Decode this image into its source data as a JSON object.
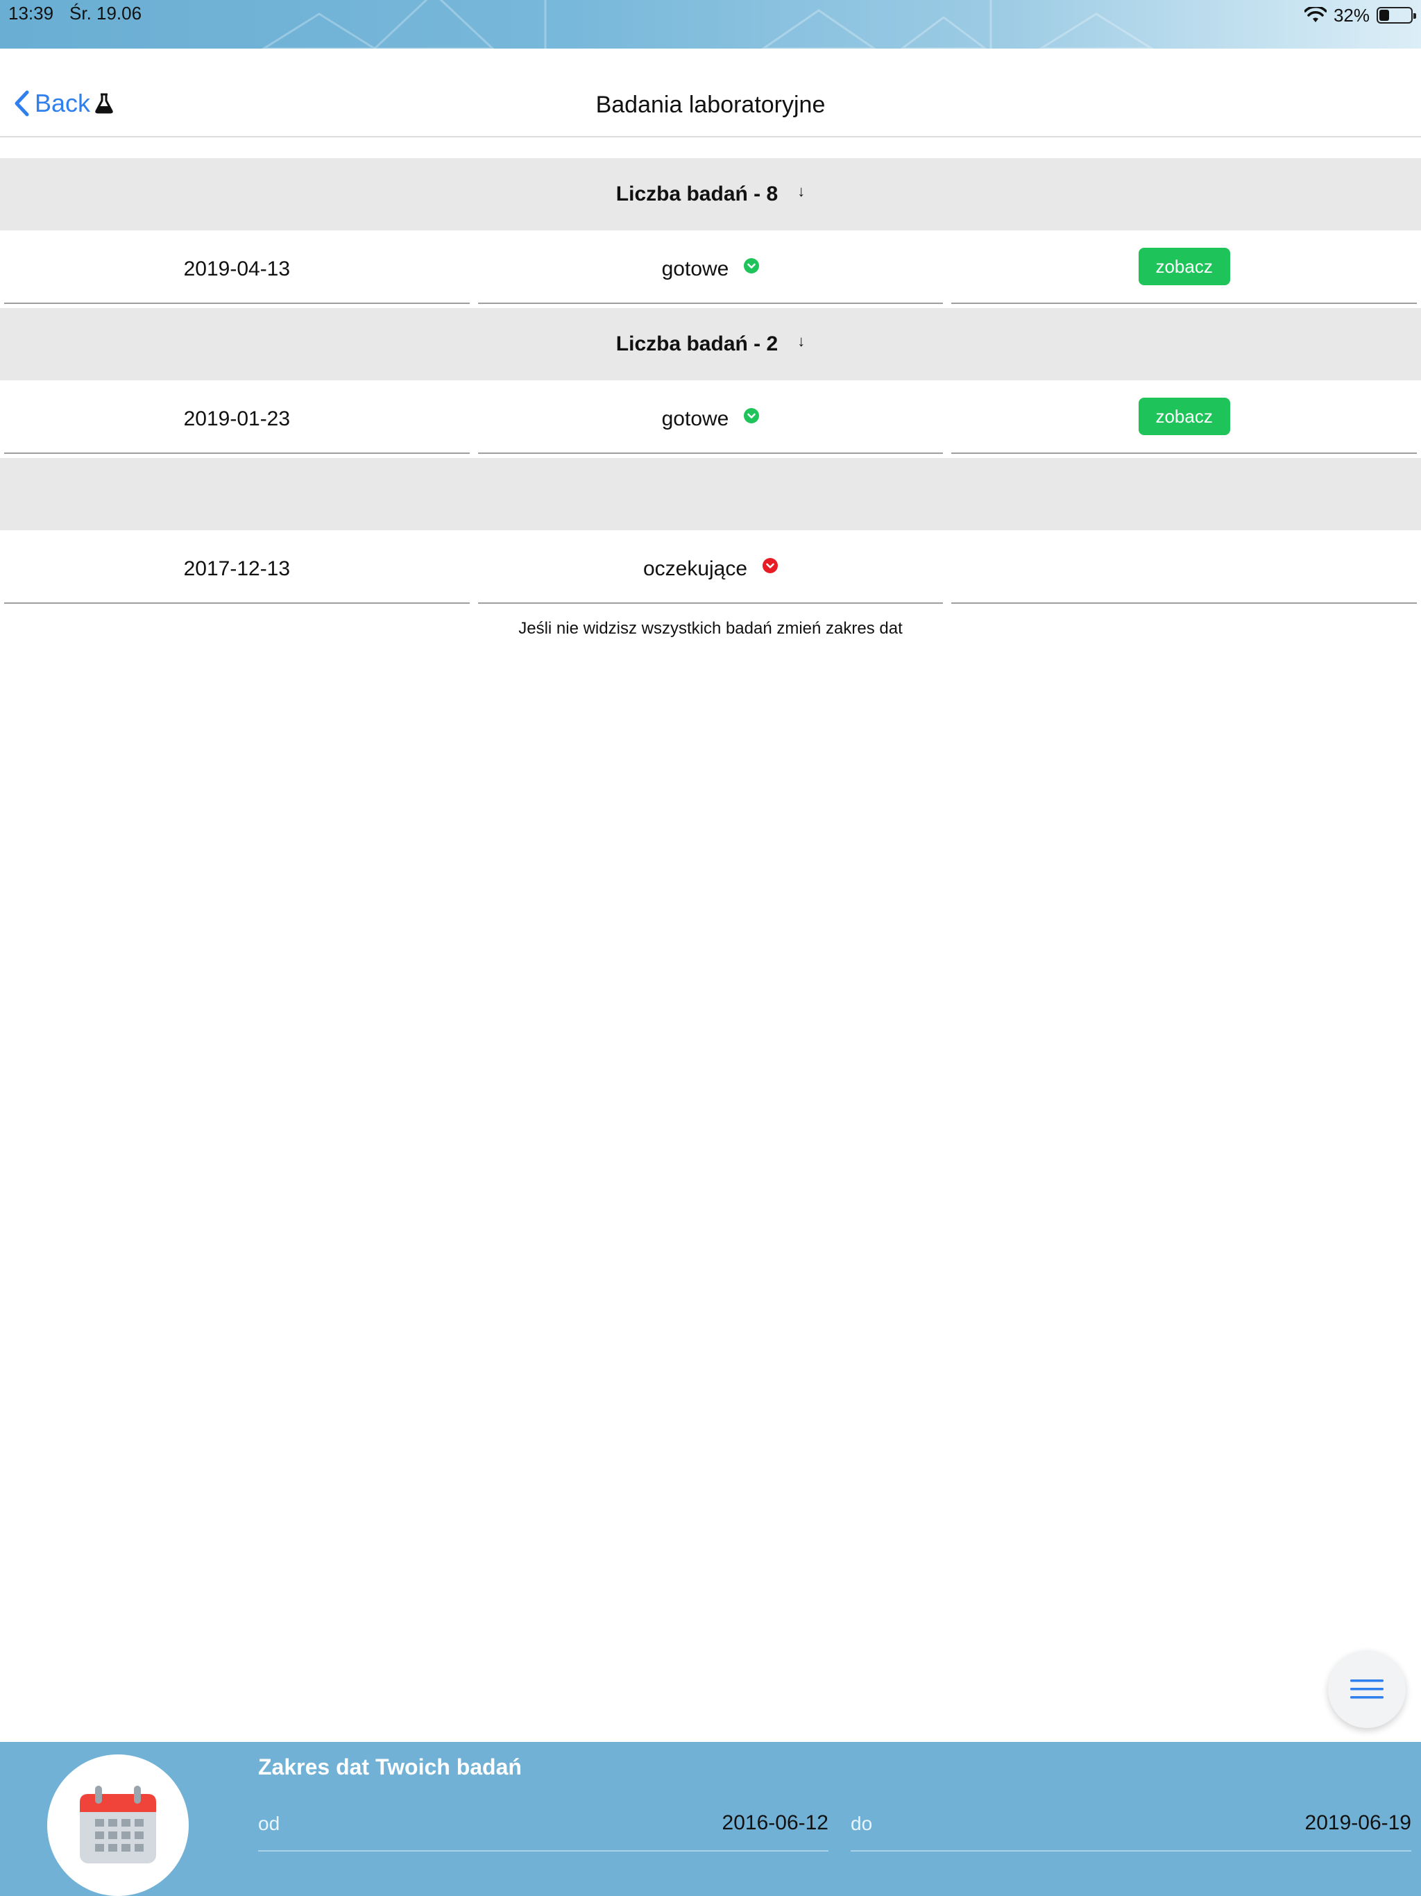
{
  "status_bar": {
    "time": "13:39",
    "date": "Śr. 19.06",
    "battery_percent": "32%",
    "battery_level": 0.32
  },
  "nav": {
    "back_label": "Back",
    "title": "Badania laboratoryjne"
  },
  "groups": [
    {
      "header": "Liczba badań - 8",
      "sort_arrow": "↓",
      "rows": [
        {
          "date": "2019-04-13",
          "status": "gotowe",
          "status_kind": "ready",
          "action": "zobacz"
        }
      ]
    },
    {
      "header": "Liczba badań - 2",
      "sort_arrow": "↓",
      "rows": [
        {
          "date": "2019-01-23",
          "status": "gotowe",
          "status_kind": "ready",
          "action": "zobacz"
        }
      ]
    },
    {
      "header": "",
      "sort_arrow": "",
      "rows": [
        {
          "date": "2017-12-13",
          "status": "oczekujące",
          "status_kind": "pending",
          "action": ""
        }
      ]
    }
  ],
  "note": "Jeśli nie widzisz wszystkich badań zmień zakres dat",
  "bottom_panel": {
    "title": "Zakres dat Twoich badań",
    "from_label": "od",
    "from_value": "2016-06-12",
    "to_label": "do",
    "to_value": "2019-06-19"
  },
  "colors": {
    "accent_blue": "#2f80ed",
    "ready_green": "#1ec45a",
    "pending_red": "#e81c25",
    "panel_blue": "#72b1d6"
  },
  "icons": {
    "back": "chevron-left-icon",
    "flask": "flask-icon",
    "ready": "check-circle-icon",
    "pending": "chevron-down-circle-icon",
    "menu": "hamburger-menu-icon",
    "calendar": "calendar-icon",
    "wifi": "wifi-icon",
    "battery": "battery-icon"
  }
}
